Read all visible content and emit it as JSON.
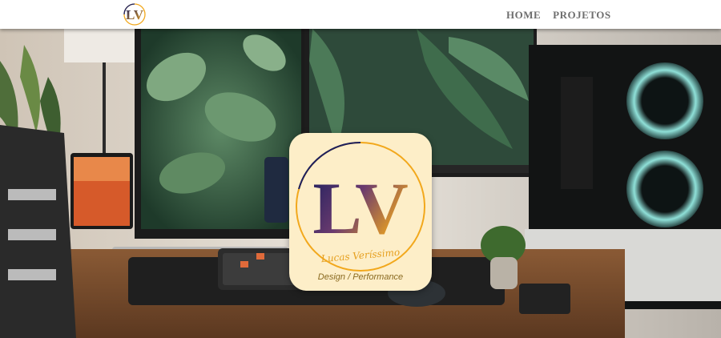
{
  "nav": {
    "logo_text": "LV",
    "links": [
      {
        "label": "HOME"
      },
      {
        "label": "PROJETOS"
      }
    ]
  },
  "hero": {
    "logo_card": {
      "monogram": "LV",
      "name": "Lucas Veríssimo",
      "tagline": "Design / Performance"
    }
  },
  "colors": {
    "nav_text": "#6e6e6e",
    "card_background": "#fdeec8",
    "brand_navy": "#1c1f5e",
    "brand_gold": "#f2a81c"
  }
}
